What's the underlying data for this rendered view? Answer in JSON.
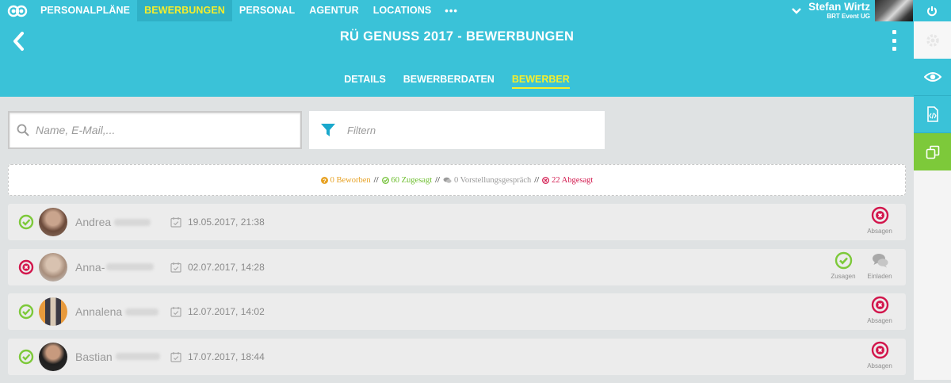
{
  "topnav": {
    "items": [
      {
        "label": "PERSONALPLÄNE"
      },
      {
        "label": "BEWERBUNGEN"
      },
      {
        "label": "PERSONAL"
      },
      {
        "label": "AGENTUR"
      },
      {
        "label": "LOCATIONS"
      }
    ],
    "more_label": "•••",
    "active_index": 1,
    "user": {
      "name": "Stefan Wirtz",
      "org": "BRT Event UG"
    }
  },
  "header": {
    "title": "RÜ GENUSS 2017 - BEWERBUNGEN",
    "tabs": [
      {
        "label": "DETAILS"
      },
      {
        "label": "BEWERBERDATEN"
      },
      {
        "label": "BEWERBER"
      }
    ],
    "active_tab": 2
  },
  "search": {
    "placeholder": "Name, E-Mail,..."
  },
  "filter": {
    "placeholder": "Filtern"
  },
  "summary": {
    "applied": "0 Beworben",
    "accepted": "60 Zugesagt",
    "interview": "0 Vorstellungsgespräch",
    "declined": "22 Abgesagt",
    "separator": "//"
  },
  "applicants": [
    {
      "first_name": "Andrea",
      "date": "19.05.2017, 21:38",
      "status": "accepted",
      "actions": [
        {
          "type": "decline",
          "label": "Absagen"
        }
      ]
    },
    {
      "first_name": "Anna-",
      "date": "02.07.2017, 14:28",
      "status": "declined",
      "actions": [
        {
          "type": "accept",
          "label": "Zusagen"
        },
        {
          "type": "invite",
          "label": "Einladen"
        }
      ]
    },
    {
      "first_name": "Annalena",
      "date": "12.07.2017, 14:02",
      "status": "accepted",
      "actions": [
        {
          "type": "decline",
          "label": "Absagen"
        }
      ]
    },
    {
      "first_name": "Bastian",
      "date": "17.07.2017, 18:44",
      "status": "accepted",
      "actions": [
        {
          "type": "decline",
          "label": "Absagen"
        }
      ]
    }
  ],
  "colors": {
    "brand": "#3ac2d8",
    "active_yellow": "#f6ee2b",
    "accepted_green": "#7dc93a",
    "declined_red": "#d2164c",
    "pending_orange": "#e7a224",
    "sidebar_green": "#7dc93a"
  },
  "icons": {
    "logo": "infinity-logo-icon",
    "user_menu": "chevron-down-icon",
    "power": "power-icon",
    "back": "chevron-left-icon",
    "more": "kebab-menu-icon",
    "search": "search-icon",
    "filter": "funnel-icon",
    "sidebar": [
      "gear-icon",
      "eye-icon",
      "code-file-icon",
      "copy-icon"
    ],
    "date": "calendar-check-icon"
  }
}
